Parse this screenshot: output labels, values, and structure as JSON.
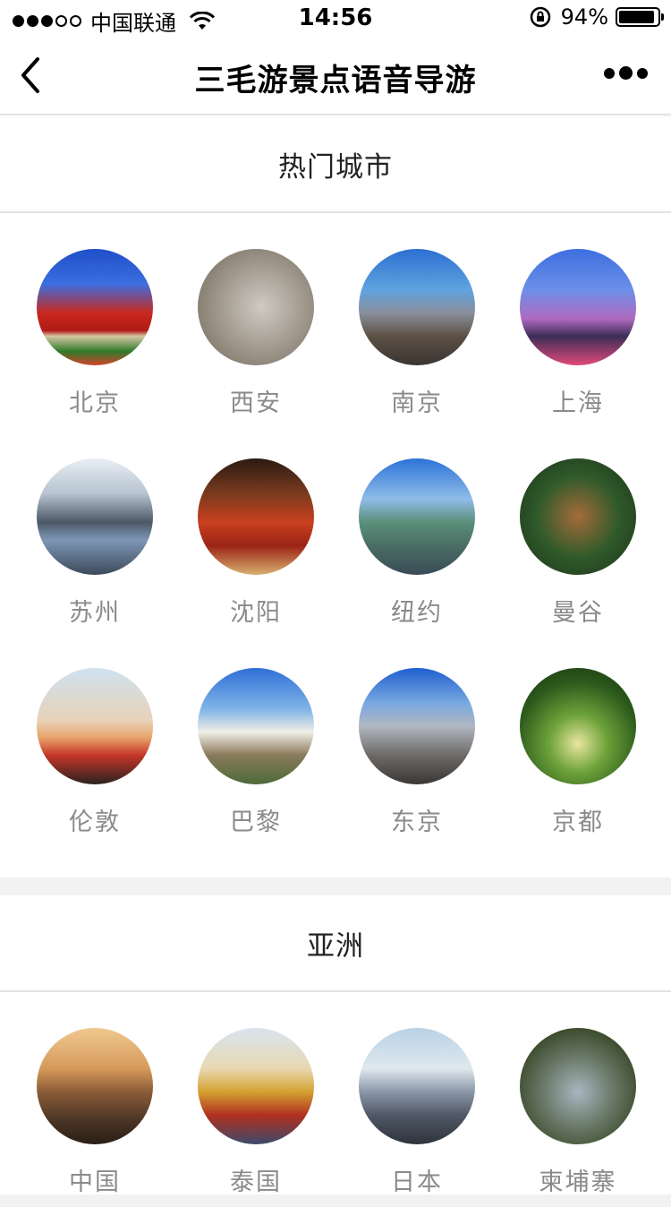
{
  "status_bar": {
    "carrier": "中国联通",
    "time": "14:56",
    "battery_percent": "94%",
    "battery_level": 0.94,
    "signal_dots_filled": 3,
    "signal_dots_total": 5
  },
  "navbar": {
    "title": "三毛游景点语音导游",
    "back_icon": "chevron-left-icon",
    "more_icon": "more-dots-icon"
  },
  "hot_cities": {
    "title": "热门城市",
    "items": [
      {
        "label": "北京",
        "scene": "g-beijing"
      },
      {
        "label": "西安",
        "scene": "g-xian"
      },
      {
        "label": "南京",
        "scene": "g-nanjing"
      },
      {
        "label": "上海",
        "scene": "g-shanghai"
      },
      {
        "label": "苏州",
        "scene": "g-suzhou"
      },
      {
        "label": "沈阳",
        "scene": "g-shenyang"
      },
      {
        "label": "纽约",
        "scene": "g-newyork"
      },
      {
        "label": "曼谷",
        "scene": "g-bangkok"
      },
      {
        "label": "伦敦",
        "scene": "g-london"
      },
      {
        "label": "巴黎",
        "scene": "g-paris"
      },
      {
        "label": "东京",
        "scene": "g-tokyo"
      },
      {
        "label": "京都",
        "scene": "g-kyoto"
      }
    ]
  },
  "asia": {
    "title": "亚洲",
    "items": [
      {
        "label": "中国",
        "scene": "g-china"
      },
      {
        "label": "泰国",
        "scene": "g-thailand"
      },
      {
        "label": "日本",
        "scene": "g-japan"
      },
      {
        "label": "柬埔寨",
        "scene": "g-cambodia"
      }
    ]
  }
}
